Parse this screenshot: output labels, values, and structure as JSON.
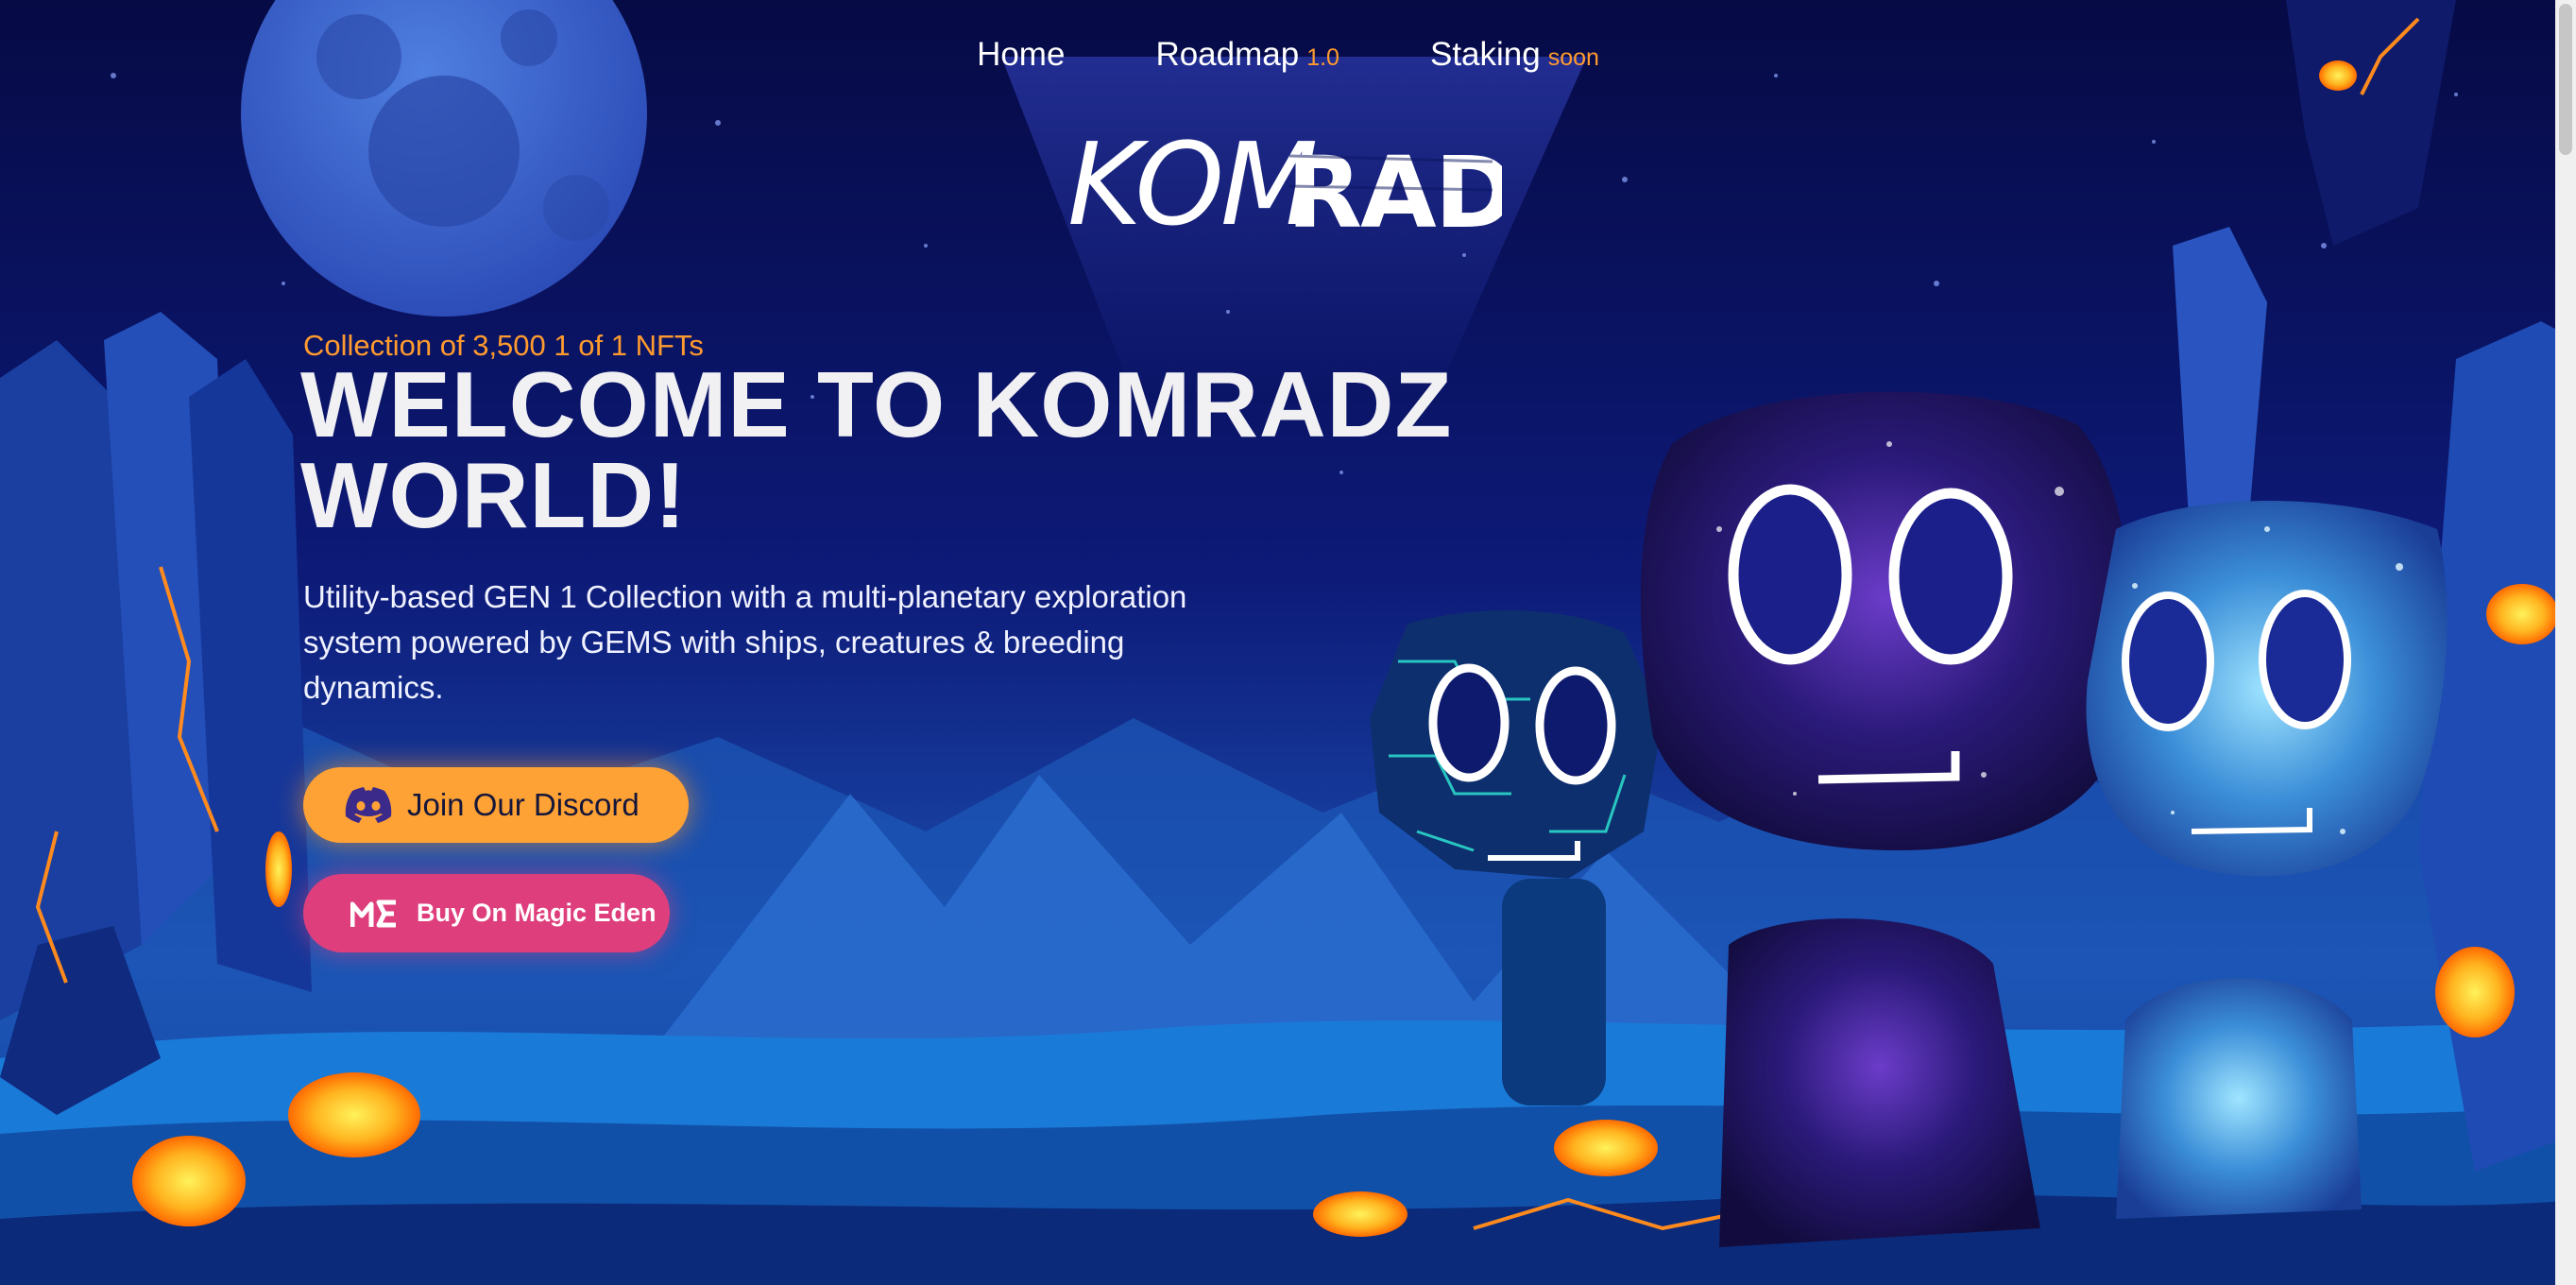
{
  "nav": {
    "items": [
      {
        "label": "Home",
        "suffix": ""
      },
      {
        "label": "Roadmap",
        "suffix": "1.0"
      },
      {
        "label": "Staking",
        "suffix": "soon"
      }
    ]
  },
  "logo": {
    "text": "KOMRADZ"
  },
  "hero": {
    "tagline": "Collection of 3,500 1 of 1 NFTs",
    "headline_line1": "WELCOME TO KOMRADZ",
    "headline_line2": "WORLD!",
    "description": "Utility-based GEN 1 Collection with a multi-planetary exploration system powered by GEMS with ships, creatures & breeding dynamics."
  },
  "buttons": {
    "discord": {
      "label": "Join Our Discord",
      "icon": "discord-icon"
    },
    "magic_eden": {
      "label": "Buy On Magic Eden",
      "icon": "magic-eden-icon"
    }
  },
  "colors": {
    "background": "#0a0f4a",
    "accent_orange": "#ffa235",
    "accent_pink": "#de3f7c",
    "headline": "#f1f1f4"
  }
}
